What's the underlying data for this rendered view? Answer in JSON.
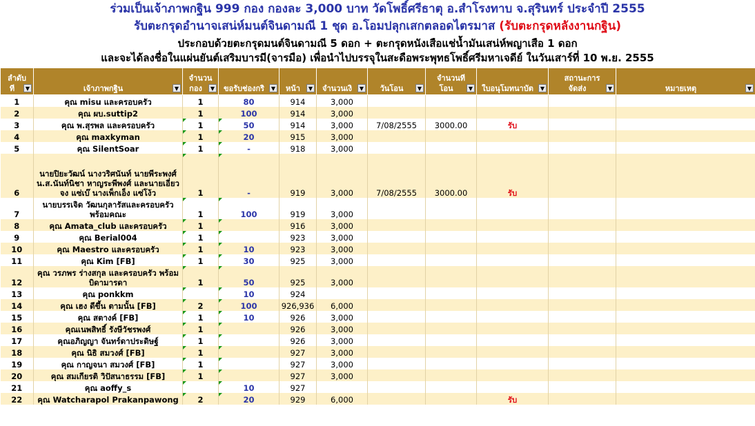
{
  "heading": {
    "line1": "ร่วมเป็นเจ้าภาพกฐิน 999 กอง  กองละ 3,000 บาท วัดโพธิ์ศรีธาตุ อ.สำโรงทาบ จ.สุรินทร์ ประจำปี 2555",
    "line2": "รับตะกรุดอำนาจเสน่ห์มนต์จินดามณี 1 ชุด  อ.โอมปลุกเสกตลอดไตรมาส ",
    "line2_red": "(รับตะกรุดหลังงานกฐิน)",
    "line3": "ประกอบด้วยตะกรุดมนต์จินดามณี 5 ดอก + ตะกรุดหนังเสือแช่น้ำมันเสน่ห์พญาเสือ 1 ดอก",
    "line4": "และจะได้ลงชื่อในแผ่นยันต์เสริมบารมี(จารมือ) เพื่อนำไปบรรจุในสะดือพระพุทธโพธิ์ศรีมหาเจดีย์ ในวันเสาร์ที่ 10 พ.ย. 2555"
  },
  "columns": [
    {
      "line1": "ลำดับ",
      "line2": "ที่"
    },
    {
      "line1": "",
      "line2": "เจ้าภาพกฐิน"
    },
    {
      "line1": "จำนวน",
      "line2": "กอง"
    },
    {
      "line1": "",
      "line2": "ขอรับช่องกริ"
    },
    {
      "line1": "",
      "line2": "หน้า"
    },
    {
      "line1": "",
      "line2": "จำนวนเงิ"
    },
    {
      "line1": "",
      "line2": "วันโอน"
    },
    {
      "line1": "จำนวนที่",
      "line2": "โอน"
    },
    {
      "line1": "",
      "line2": "ใบอนุโมทนาบัต"
    },
    {
      "line1": "สถานะการ",
      "line2": "จัดส่ง"
    },
    {
      "line1": "",
      "line2": "หมายเหตุ"
    }
  ],
  "dropdown_icon": "filter-dropdown-arrow",
  "rows": [
    {
      "no": "1",
      "name": "คุณ misu และครอบครัว",
      "kong": "1",
      "slot": "80",
      "page": "914",
      "amount": "3,000",
      "date": "",
      "xfer": "",
      "ack": ""
    },
    {
      "no": "2",
      "name": "คุณ ผบ.suttip2",
      "kong": "1",
      "slot": "100",
      "page": "914",
      "amount": "3,000",
      "date": "",
      "xfer": "",
      "ack": ""
    },
    {
      "no": "3",
      "name": "คุณ พ.สุรพล และครอบครัว",
      "kong": "1",
      "slot": "50",
      "page": "914",
      "amount": "3,000",
      "date": "7/08/2555",
      "xfer": "3000.00",
      "ack": "รับ"
    },
    {
      "no": "4",
      "name": "คุณ maxkyman",
      "kong": "1",
      "slot": "20",
      "page": "915",
      "amount": "3,000",
      "date": "",
      "xfer": "",
      "ack": ""
    },
    {
      "no": "5",
      "name": "คุณ SilentSoar",
      "kong": "1",
      "slot": "-",
      "page": "918",
      "amount": "3,000",
      "date": "",
      "xfer": "",
      "ack": ""
    },
    {
      "no": "6",
      "name": "นายปิยะวัฒน์ นางวริศนันท์ นายพีระพงศ์ น.ส.นันท์นิชา หาญระพีพงศ์ และนายเอี่ยวจง แซ่เบ๊ นางเพ็กเอ็ง แซ่โง้ว",
      "kong": "1",
      "slot": "-",
      "page": "919",
      "amount": "3,000",
      "date": "7/08/2555",
      "xfer": "3000.00",
      "ack": "รับ"
    },
    {
      "no": "7",
      "name": "นายบรรเจิด วัฒนกุลารัสและครอบครัว พร้อมคณะ",
      "kong": "1",
      "slot": "100",
      "page": "919",
      "amount": "3,000",
      "date": "",
      "xfer": "",
      "ack": ""
    },
    {
      "no": "8",
      "name": "คุณ Amata_club และครอบครัว",
      "kong": "1",
      "slot": "",
      "page": "916",
      "amount": "3,000",
      "date": "",
      "xfer": "",
      "ack": ""
    },
    {
      "no": "9",
      "name": "คุณ Berial004",
      "kong": "1",
      "slot": "",
      "page": "923",
      "amount": "3,000",
      "date": "",
      "xfer": "",
      "ack": ""
    },
    {
      "no": "10",
      "name": "คุณ Maestro และครอบครัว",
      "kong": "1",
      "slot": "10",
      "page": "923",
      "amount": "3,000",
      "date": "",
      "xfer": "",
      "ack": ""
    },
    {
      "no": "11",
      "name": "คุณ Kim [FB]",
      "kong": "1",
      "slot": "30",
      "page": "925",
      "amount": "3,000",
      "date": "",
      "xfer": "",
      "ack": ""
    },
    {
      "no": "12",
      "name": "คุณ วรภพร ร่างสกุล และครอบครัว พร้อมบิดามารดา",
      "kong": "1",
      "slot": "50",
      "page": "925",
      "amount": "3,000",
      "date": "",
      "xfer": "",
      "ack": ""
    },
    {
      "no": "13",
      "name": "คุณ ponkkm",
      "kong": "",
      "slot": "10",
      "page": "924",
      "amount": "",
      "date": "",
      "xfer": "",
      "ack": ""
    },
    {
      "no": "14",
      "name": "คุณ เฮง ดีขึ้น ตามนั้น [FB]",
      "kong": "2",
      "slot": "100",
      "page": "926,936",
      "amount": "6,000",
      "date": "",
      "xfer": "",
      "ack": ""
    },
    {
      "no": "15",
      "name": "คุณ สตางค์ [FB]",
      "kong": "1",
      "slot": "10",
      "page": "926",
      "amount": "3,000",
      "date": "",
      "xfer": "",
      "ack": ""
    },
    {
      "no": "16",
      "name": "คุณเนพสิทธิ์ รังษีวัชรพงศ์",
      "kong": "1",
      "slot": "",
      "page": "926",
      "amount": "3,000",
      "date": "",
      "xfer": "",
      "ack": ""
    },
    {
      "no": "17",
      "name": "คุณอภิญญา จันทร์ดาประดิษฐ์",
      "kong": "1",
      "slot": "",
      "page": "926",
      "amount": "3,000",
      "date": "",
      "xfer": "",
      "ack": ""
    },
    {
      "no": "18",
      "name": "คุณ นิธิ สมวงศ์ [FB]",
      "kong": "1",
      "slot": "",
      "page": "927",
      "amount": "3,000",
      "date": "",
      "xfer": "",
      "ack": ""
    },
    {
      "no": "19",
      "name": "คุณ กาญจนา สมวงศ์ [FB]",
      "kong": "1",
      "slot": "",
      "page": "927",
      "amount": "3,000",
      "date": "",
      "xfer": "",
      "ack": ""
    },
    {
      "no": "20",
      "name": "คุณ สมเกียรติ วิปัสนาธรรม [FB]",
      "kong": "1",
      "slot": "",
      "page": "927",
      "amount": "3,000",
      "date": "",
      "xfer": "",
      "ack": ""
    },
    {
      "no": "21",
      "name": "คุณ aoffy_s",
      "kong": "",
      "slot": "10",
      "page": "927",
      "amount": "",
      "date": "",
      "xfer": "",
      "ack": ""
    },
    {
      "no": "22",
      "name": "คุณ Watcharapol Prakanpawong",
      "kong": "2",
      "slot": "20",
      "page": "929",
      "amount": "6,000",
      "date": "",
      "xfer": "",
      "ack": "รับ"
    }
  ]
}
